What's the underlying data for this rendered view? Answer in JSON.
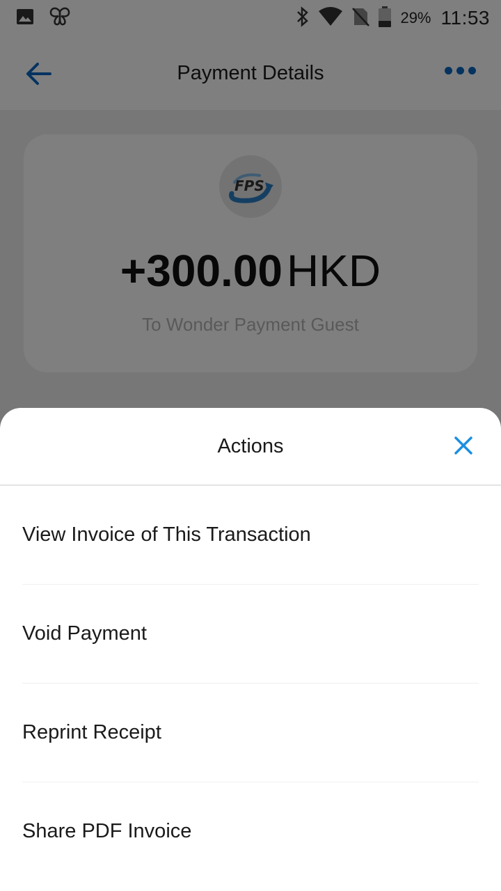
{
  "status_bar": {
    "battery_percent": "29%",
    "time": "11:53",
    "icons": [
      "gallery-icon",
      "butterfly-icon",
      "bluetooth-icon",
      "wifi-icon",
      "no-sim-icon",
      "battery-icon"
    ]
  },
  "header": {
    "title": "Payment Details",
    "back_icon": "back-arrow-icon",
    "more_icon": "more-dots-icon",
    "accent_color": "#0a67c0"
  },
  "payment_card": {
    "logo_text": "FPS",
    "amount": "+300.00",
    "currency": "HKD",
    "recipient": "To Wonder Payment Guest"
  },
  "actions_sheet": {
    "title": "Actions",
    "close_icon": "close-icon",
    "close_color": "#1a8fe0",
    "items": [
      {
        "label": "View Invoice of This Transaction"
      },
      {
        "label": "Void Payment"
      },
      {
        "label": "Reprint Receipt"
      },
      {
        "label": "Share PDF Invoice"
      }
    ]
  }
}
